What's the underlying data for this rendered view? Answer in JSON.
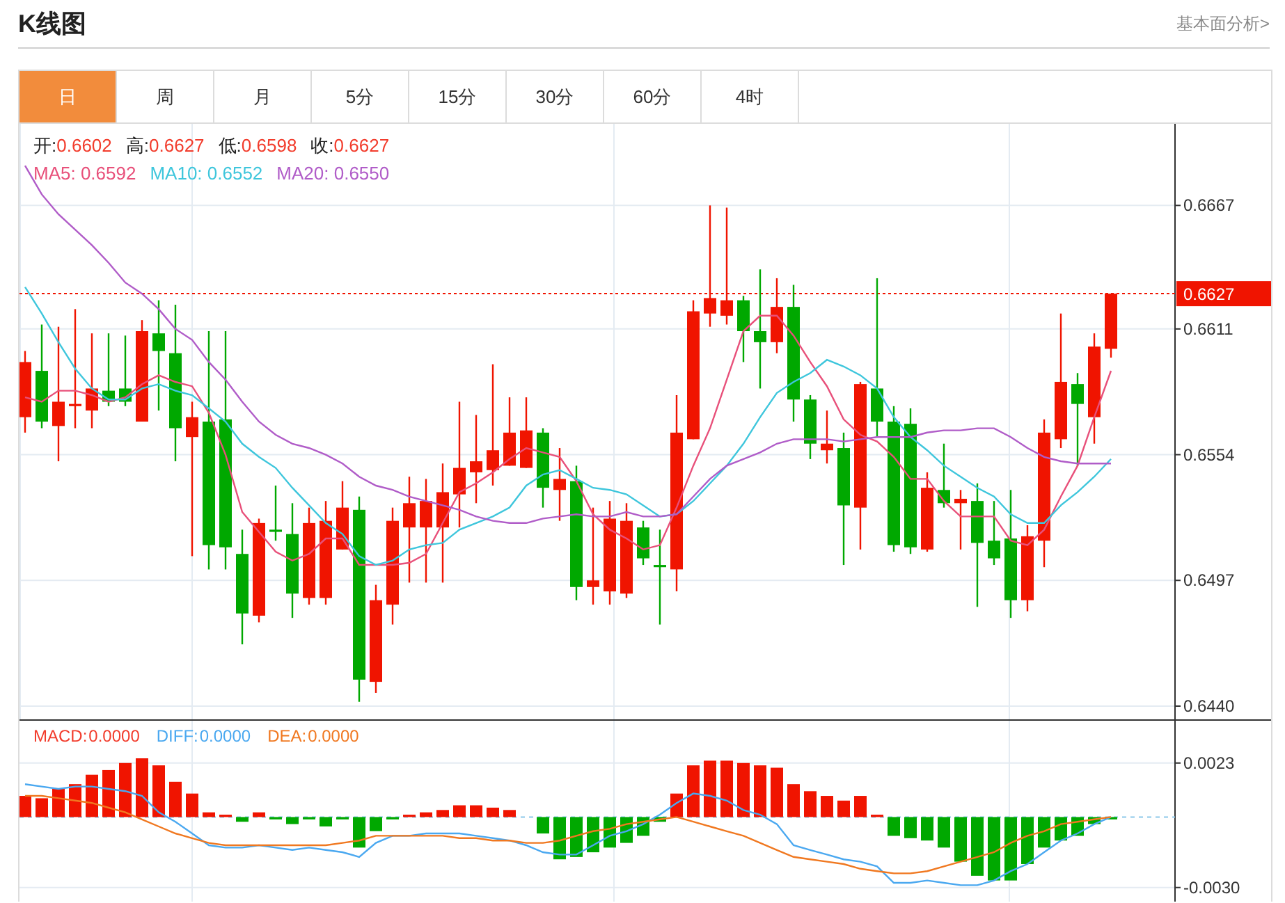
{
  "header": {
    "title": "K线图",
    "link": "基本面分析>"
  },
  "tabs": [
    {
      "label": "日",
      "selected": true
    },
    {
      "label": "周",
      "selected": false
    },
    {
      "label": "月",
      "selected": false
    },
    {
      "label": "5分",
      "selected": false
    },
    {
      "label": "15分",
      "selected": false
    },
    {
      "label": "30分",
      "selected": false
    },
    {
      "label": "60分",
      "selected": false
    },
    {
      "label": "4时",
      "selected": false
    }
  ],
  "price_panel": {
    "ohlc_legend": [
      {
        "label": "开:",
        "value": "0.6602"
      },
      {
        "label": "高:",
        "value": "0.6627"
      },
      {
        "label": "低:",
        "value": "0.6598"
      },
      {
        "label": "收:",
        "value": "0.6627"
      }
    ],
    "ma_legend": [
      {
        "label": "MA5:",
        "value": "0.6592",
        "color": "#e8507a"
      },
      {
        "label": "MA10:",
        "value": "0.6552",
        "color": "#3ec6dc"
      },
      {
        "label": "MA20:",
        "value": "0.6550",
        "color": "#b05cc8"
      }
    ],
    "chart_data": {
      "type": "candlestick",
      "grid": true,
      "ylim": [
        0.6434,
        0.6704
      ],
      "yticks": [
        {
          "value": 0.6667,
          "label": "0.6667"
        },
        {
          "value": 0.6611,
          "label": "0.6611"
        },
        {
          "value": 0.6554,
          "label": "0.6554"
        },
        {
          "value": 0.6497,
          "label": "0.6497"
        },
        {
          "value": 0.644,
          "label": "0.6440"
        }
      ],
      "ref_lines": [
        {
          "axis": "y",
          "value": 0.6627,
          "label": "0.6627",
          "color": "#f01400"
        }
      ],
      "ohlc": [
        [
          0.6571,
          0.6601,
          0.6564,
          0.6596
        ],
        [
          0.6592,
          0.6613,
          0.6566,
          0.6569
        ],
        [
          0.6567,
          0.6612,
          0.6551,
          0.6578
        ],
        [
          0.6576,
          0.662,
          0.6566,
          0.6577
        ],
        [
          0.6574,
          0.6609,
          0.6566,
          0.6584
        ],
        [
          0.6583,
          0.6609,
          0.6576,
          0.6578
        ],
        [
          0.6584,
          0.6608,
          0.6576,
          0.6578
        ],
        [
          0.6569,
          0.6615,
          0.6569,
          0.661
        ],
        [
          0.6609,
          0.6624,
          0.6574,
          0.6601
        ],
        [
          0.66,
          0.6622,
          0.6551,
          0.6566
        ],
        [
          0.6562,
          0.6578,
          0.6508,
          0.6571
        ],
        [
          0.6569,
          0.661,
          0.6502,
          0.6513
        ],
        [
          0.657,
          0.661,
          0.6502,
          0.6512
        ],
        [
          0.6509,
          0.652,
          0.6468,
          0.6482
        ],
        [
          0.6481,
          0.6525,
          0.6478,
          0.6523
        ],
        [
          0.652,
          0.654,
          0.6515,
          0.6519
        ],
        [
          0.6518,
          0.6532,
          0.648,
          0.6491
        ],
        [
          0.6489,
          0.653,
          0.6486,
          0.6523
        ],
        [
          0.6489,
          0.6533,
          0.6486,
          0.6524
        ],
        [
          0.6511,
          0.6542,
          0.6511,
          0.653
        ],
        [
          0.6529,
          0.6535,
          0.6442,
          0.6452
        ],
        [
          0.6451,
          0.6495,
          0.6446,
          0.6488
        ],
        [
          0.6486,
          0.653,
          0.6477,
          0.6524
        ],
        [
          0.6521,
          0.6544,
          0.6496,
          0.6532
        ],
        [
          0.6521,
          0.6543,
          0.6496,
          0.6533
        ],
        [
          0.6521,
          0.655,
          0.6496,
          0.6537
        ],
        [
          0.6536,
          0.6578,
          0.6521,
          0.6548
        ],
        [
          0.6546,
          0.6572,
          0.6532,
          0.6551
        ],
        [
          0.6547,
          0.6595,
          0.654,
          0.6556
        ],
        [
          0.6549,
          0.658,
          0.6549,
          0.6564
        ],
        [
          0.6548,
          0.658,
          0.6548,
          0.6565
        ],
        [
          0.6564,
          0.6566,
          0.653,
          0.6539
        ],
        [
          0.6538,
          0.6557,
          0.6524,
          0.6543
        ],
        [
          0.6542,
          0.6549,
          0.6488,
          0.6494
        ],
        [
          0.6494,
          0.653,
          0.6486,
          0.6497
        ],
        [
          0.6492,
          0.6533,
          0.6486,
          0.6525
        ],
        [
          0.6491,
          0.6532,
          0.6489,
          0.6524
        ],
        [
          0.6521,
          0.6524,
          0.6504,
          0.6507
        ],
        [
          0.6504,
          0.652,
          0.6477,
          0.6503
        ],
        [
          0.6502,
          0.6581,
          0.6492,
          0.6564
        ],
        [
          0.6561,
          0.6624,
          0.6561,
          0.6619
        ],
        [
          0.6618,
          0.6667,
          0.6612,
          0.6625
        ],
        [
          0.6617,
          0.6666,
          0.6613,
          0.6624
        ],
        [
          0.6624,
          0.6626,
          0.6596,
          0.661
        ],
        [
          0.661,
          0.6638,
          0.6584,
          0.6605
        ],
        [
          0.6605,
          0.6634,
          0.66,
          0.6621
        ],
        [
          0.6621,
          0.6631,
          0.6569,
          0.6579
        ],
        [
          0.6579,
          0.6581,
          0.6552,
          0.6559
        ],
        [
          0.6556,
          0.6574,
          0.655,
          0.6559
        ],
        [
          0.6557,
          0.6564,
          0.6504,
          0.6531
        ],
        [
          0.653,
          0.6587,
          0.6511,
          0.6586
        ],
        [
          0.6584,
          0.6634,
          0.6562,
          0.6569
        ],
        [
          0.6569,
          0.6576,
          0.651,
          0.6513
        ],
        [
          0.6568,
          0.6575,
          0.6509,
          0.6512
        ],
        [
          0.6511,
          0.6546,
          0.651,
          0.6539
        ],
        [
          0.6538,
          0.6559,
          0.653,
          0.6532
        ],
        [
          0.6532,
          0.6538,
          0.6511,
          0.6534
        ],
        [
          0.6533,
          0.6541,
          0.6485,
          0.6514
        ],
        [
          0.6515,
          0.6533,
          0.6504,
          0.6507
        ],
        [
          0.6516,
          0.6538,
          0.648,
          0.6488
        ],
        [
          0.6488,
          0.6522,
          0.6483,
          0.6517
        ],
        [
          0.6515,
          0.657,
          0.6503,
          0.6564
        ],
        [
          0.6561,
          0.6618,
          0.6557,
          0.6587
        ],
        [
          0.6586,
          0.6591,
          0.6549,
          0.6577
        ],
        [
          0.6571,
          0.6609,
          0.6559,
          0.6603
        ],
        [
          0.6602,
          0.6627,
          0.6598,
          0.6627
        ]
      ],
      "series": [
        {
          "type": "line",
          "color": "#e8507a",
          "values": [
            0.658,
            0.6578,
            0.6583,
            0.6583,
            0.6581,
            0.6578,
            0.658,
            0.6586,
            0.659,
            0.6587,
            0.6585,
            0.6573,
            0.6554,
            0.6528,
            0.6519,
            0.651,
            0.6506,
            0.6509,
            0.6516,
            0.6516,
            0.6504,
            0.6504,
            0.6504,
            0.6505,
            0.6509,
            0.6523,
            0.6537,
            0.6541,
            0.6546,
            0.6552,
            0.6557,
            0.6555,
            0.6553,
            0.6542,
            0.6527,
            0.652,
            0.6516,
            0.6511,
            0.6513,
            0.653,
            0.6549,
            0.6566,
            0.6588,
            0.661,
            0.6617,
            0.6617,
            0.6608,
            0.6596,
            0.6585,
            0.657,
            0.6563,
            0.656,
            0.6553,
            0.6543,
            0.6543,
            0.6533,
            0.6526,
            0.6526,
            0.6526,
            0.6515,
            0.6513,
            0.652,
            0.6535,
            0.6549,
            0.6571,
            0.6592
          ]
        },
        {
          "type": "line",
          "color": "#3ec6dc",
          "values": [
            0.663,
            0.6618,
            0.6605,
            0.6593,
            0.6584,
            0.6579,
            0.6579,
            0.6584,
            0.6586,
            0.6583,
            0.6581,
            0.6575,
            0.6569,
            0.6559,
            0.6553,
            0.6548,
            0.6539,
            0.6531,
            0.6523,
            0.6518,
            0.6508,
            0.6504,
            0.6506,
            0.6511,
            0.6513,
            0.6514,
            0.652,
            0.6523,
            0.6526,
            0.653,
            0.654,
            0.6545,
            0.6547,
            0.6543,
            0.6539,
            0.6538,
            0.6536,
            0.6531,
            0.6526,
            0.6527,
            0.6533,
            0.6541,
            0.6549,
            0.6559,
            0.6571,
            0.6582,
            0.6587,
            0.6591,
            0.6597,
            0.6594,
            0.659,
            0.6584,
            0.6571,
            0.6562,
            0.6556,
            0.6549,
            0.6544,
            0.6539,
            0.6535,
            0.6527,
            0.6523,
            0.6523,
            0.6531,
            0.6537,
            0.6544,
            0.6552
          ]
        },
        {
          "type": "line",
          "color": "#b05cc8",
          "values": [
            0.6685,
            0.6672,
            0.6663,
            0.6656,
            0.6649,
            0.6641,
            0.6632,
            0.6627,
            0.662,
            0.6611,
            0.6606,
            0.6596,
            0.6588,
            0.6578,
            0.6569,
            0.6563,
            0.6559,
            0.6557,
            0.6554,
            0.655,
            0.6544,
            0.654,
            0.6538,
            0.6535,
            0.6533,
            0.6531,
            0.6529,
            0.6526,
            0.6524,
            0.6523,
            0.6523,
            0.6525,
            0.6526,
            0.6527,
            0.6526,
            0.6526,
            0.6528,
            0.6526,
            0.6526,
            0.6527,
            0.6535,
            0.6543,
            0.6549,
            0.6552,
            0.6555,
            0.6559,
            0.6561,
            0.6561,
            0.6561,
            0.656,
            0.6561,
            0.6562,
            0.6562,
            0.6562,
            0.6564,
            0.6565,
            0.6565,
            0.6566,
            0.6566,
            0.6562,
            0.6557,
            0.6553,
            0.6551,
            0.655,
            0.655,
            0.655
          ]
        }
      ]
    }
  },
  "macd_panel": {
    "legend": [
      {
        "label": "MACD:",
        "value": "0.0000",
        "color": "#f23c2c"
      },
      {
        "label": "DIFF:",
        "value": "0.0000",
        "color": "#4aa8f0"
      },
      {
        "label": "DEA:",
        "value": "0.0000",
        "color": "#f07820"
      }
    ],
    "chart_data": {
      "type": "bar",
      "grid": true,
      "ylim": [
        -0.0036,
        0.0041
      ],
      "ref_lines": [
        {
          "axis": "y",
          "value": 0,
          "color": "#8cc8ea"
        }
      ],
      "yticks": [
        {
          "value": 0.0023,
          "label": "0.0023"
        },
        {
          "value": -0.003,
          "label": "-0.0030"
        }
      ],
      "series": [
        {
          "type": "bar",
          "color": "#f01400",
          "values": [
            0.0009,
            0.0008,
            0.0012,
            0.0014,
            0.0018,
            0.002,
            0.0023,
            0.0025,
            0.0022,
            0.0015,
            0.001,
            0.0002,
            0.0001,
            null,
            0.0002,
            null,
            null,
            null,
            null,
            null,
            null,
            null,
            null,
            0.0001,
            0.0002,
            0.0003,
            0.0005,
            0.0005,
            0.0004,
            0.0003,
            null,
            null,
            null,
            null,
            null,
            null,
            null,
            null,
            null,
            0.001,
            0.0022,
            0.0024,
            0.0024,
            0.0023,
            0.0022,
            0.0021,
            0.0014,
            0.0011,
            0.0009,
            0.0007,
            0.0009,
            0.0001,
            null,
            null,
            null,
            null,
            null,
            null,
            null,
            null,
            null,
            null,
            null,
            null,
            null,
            null
          ]
        },
        {
          "type": "bar",
          "color": "#00a800",
          "values": [
            null,
            null,
            null,
            null,
            null,
            null,
            null,
            null,
            null,
            null,
            null,
            null,
            null,
            -0.0002,
            null,
            -0.0001,
            -0.0003,
            -0.0001,
            -0.0004,
            -0.0001,
            -0.0013,
            -0.0006,
            -0.0001,
            null,
            null,
            null,
            null,
            null,
            null,
            null,
            null,
            -0.0007,
            -0.0018,
            -0.0017,
            -0.0015,
            -0.0013,
            -0.0011,
            -0.0008,
            -0.0002,
            null,
            null,
            null,
            null,
            null,
            null,
            null,
            null,
            null,
            null,
            null,
            null,
            null,
            -0.0008,
            -0.0009,
            -0.001,
            -0.0013,
            -0.0019,
            -0.0025,
            -0.0027,
            -0.0027,
            -0.002,
            -0.0013,
            -0.001,
            -0.0008,
            -0.0003,
            -0.0001
          ]
        },
        {
          "type": "line",
          "color": "#4aa8f0",
          "values": [
            0.0014,
            0.0013,
            0.0012,
            0.0013,
            0.0013,
            0.0012,
            0.0011,
            0.0009,
            0.0002,
            -0.0002,
            -0.0007,
            -0.0012,
            -0.0013,
            -0.0013,
            -0.0012,
            -0.0013,
            -0.0014,
            -0.0013,
            -0.0014,
            -0.0015,
            -0.0017,
            -0.0011,
            -0.0008,
            -0.0008,
            -0.0007,
            -0.0007,
            -0.0007,
            -0.0008,
            -0.0009,
            -0.001,
            -0.0012,
            -0.0015,
            -0.0016,
            -0.0016,
            -0.0012,
            -0.0008,
            -0.0006,
            -0.0003,
            0.0001,
            0.0006,
            0.001,
            0.0009,
            0.0007,
            0.0003,
            0.0001,
            -0.0003,
            -0.0012,
            -0.0014,
            -0.0016,
            -0.0018,
            -0.0019,
            -0.0021,
            -0.0028,
            -0.0028,
            -0.0027,
            -0.0028,
            -0.0029,
            -0.0029,
            -0.0027,
            -0.0023,
            -0.002,
            -0.0015,
            -0.001,
            -0.0007,
            -0.0003,
            0
          ]
        },
        {
          "type": "line",
          "color": "#f07820",
          "values": [
            0.0009,
            0.0009,
            0.0008,
            0.0007,
            0.0006,
            0.0004,
            0.0002,
            -0.0001,
            -0.0004,
            -0.0007,
            -0.0009,
            -0.0011,
            -0.0012,
            -0.0012,
            -0.0012,
            -0.0012,
            -0.0012,
            -0.0012,
            -0.0012,
            -0.0011,
            -0.001,
            -0.0008,
            -0.0008,
            -0.0008,
            -0.0008,
            -0.0008,
            -0.0009,
            -0.0009,
            -0.001,
            -0.001,
            -0.0011,
            -0.0011,
            -0.001,
            -0.0008,
            -0.0006,
            -0.0005,
            -0.0003,
            -0.0002,
            -0.0001,
            0,
            -0.0002,
            -0.0004,
            -0.0006,
            -0.0008,
            -0.0011,
            -0.0014,
            -0.0017,
            -0.0018,
            -0.0019,
            -0.002,
            -0.0022,
            -0.0023,
            -0.0024,
            -0.0024,
            -0.0023,
            -0.0021,
            -0.0019,
            -0.0017,
            -0.0015,
            -0.0011,
            -0.0008,
            -0.0006,
            -0.0003,
            -0.0002,
            -0.0001,
            0
          ]
        }
      ]
    }
  }
}
